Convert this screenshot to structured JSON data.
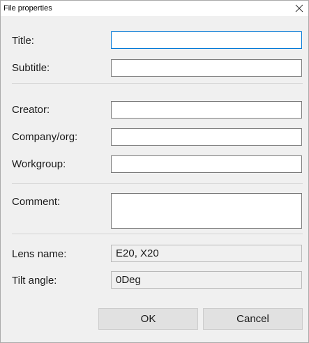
{
  "window": {
    "title": "File properties",
    "close_glyph": "✕"
  },
  "fields": {
    "title": {
      "label": "Title:",
      "value": ""
    },
    "subtitle": {
      "label": "Subtitle:",
      "value": ""
    },
    "creator": {
      "label": "Creator:",
      "value": ""
    },
    "company": {
      "label": "Company/org:",
      "value": ""
    },
    "workgroup": {
      "label": "Workgroup:",
      "value": ""
    },
    "comment": {
      "label": "Comment:",
      "value": ""
    },
    "lens_name": {
      "label": "Lens name:",
      "value": "E20, X20"
    },
    "tilt_angle": {
      "label": "Tilt angle:",
      "value": "0Deg"
    }
  },
  "buttons": {
    "ok": "OK",
    "cancel": "Cancel"
  },
  "colors": {
    "accent": "#0078d7",
    "dialog_background": "#f0f0f0",
    "button_face": "#e1e1e1"
  }
}
